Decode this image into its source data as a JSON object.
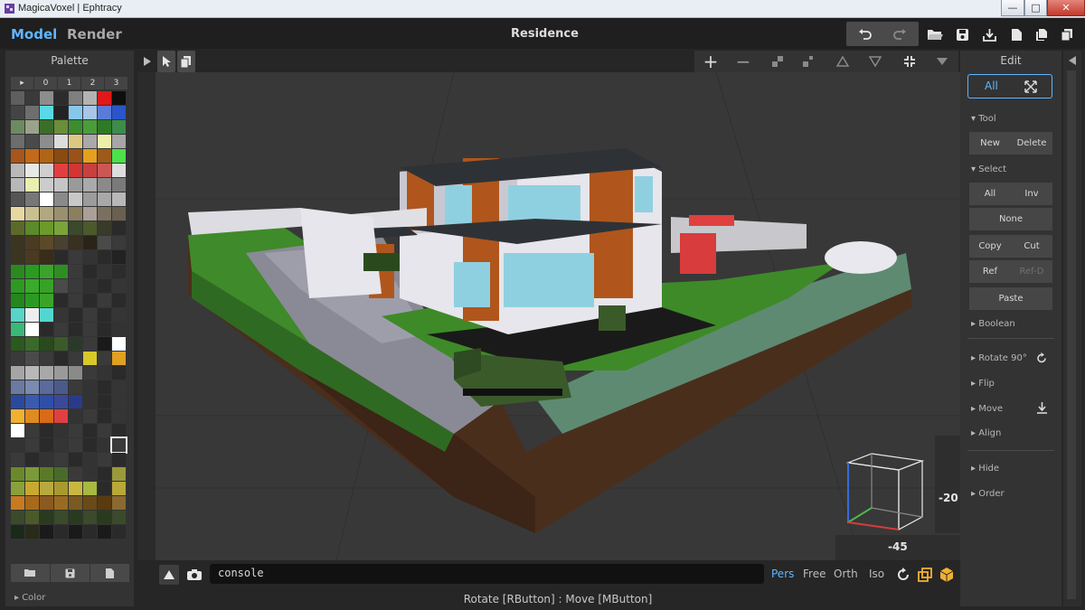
{
  "window": {
    "title": "MagicaVoxel | Ephtracy",
    "minimize_label": "—",
    "maximize_label": "□",
    "close_label": "✕"
  },
  "header": {
    "tabs": [
      {
        "label": "Model",
        "active": true
      },
      {
        "label": "Render",
        "active": false
      }
    ],
    "document_title": "Residence",
    "toolbar_icons": [
      "undo-icon",
      "redo-icon",
      "open-folder-icon",
      "save-icon",
      "export-icon",
      "new-file-icon",
      "copy-file-icon"
    ]
  },
  "palette": {
    "title": "Palette",
    "columns": [
      "▸",
      "0",
      "1",
      "2",
      "3"
    ],
    "section_label": "Color",
    "tools": [
      "open-folder-icon",
      "save-icon",
      "file-icon"
    ],
    "colors": [
      "#5f5f5f",
      "#3a3a3a",
      "#8d8d8d",
      "#2c2c2c",
      "#7f7f7f",
      "#b3b3b3",
      "#e01818",
      "#0e0e0e",
      "#444444",
      "#6e6e6e",
      "#5ad8e6",
      "#232323",
      "#86c8ec",
      "#a7c6e8",
      "#5a7cd8",
      "#2b55c9",
      "#6e8a61",
      "#9aa28a",
      "#3a6e2a",
      "#6a8e3a",
      "#3a8e2e",
      "#4a9e3a",
      "#2e7a26",
      "#3c8c4a",
      "#6d6d6d",
      "#4a4a4a",
      "#8d8d8d",
      "#dcdcdc",
      "#dcc883",
      "#a9a9a9",
      "#eeeeaa",
      "#a6a6a6",
      "#a8561a",
      "#c26a1a",
      "#b06418",
      "#8a4a10",
      "#9a5218",
      "#e6a020",
      "#9e5a1a",
      "#4ce04a",
      "#b9b9b9",
      "#e8e8e8",
      "#cfcfcf",
      "#e04040",
      "#d43434",
      "#c84040",
      "#cc5656",
      "#dddddd",
      "#b8b8b8",
      "#e8f0b0",
      "#cccccc",
      "#c5c5c5",
      "#9a9a9a",
      "#aaaaaa",
      "#8a8a8a",
      "#7a7a7a",
      "#555555",
      "#777777",
      "#ffffff",
      "#8a8a8a",
      "#c8c8c8",
      "#9c9c9c",
      "#a8a8a8",
      "#b8b8b8",
      "#e6d8a0",
      "#c8c090",
      "#b0a880",
      "#9a9070",
      "#8a8060",
      "#aaa098",
      "#7a7060",
      "#6a6050",
      "#5b6a2a",
      "#5a8a2a",
      "#6a9a2a",
      "#7aa43a",
      "#3a4a2a",
      "#4a5a2a",
      "#3a3a2a",
      "#2a2a2a",
      "#3b3520",
      "#4a3c22",
      "#5a4a2a",
      "#4a4030",
      "#3a3020",
      "#2a2418",
      "#4a4a4a",
      "#3a3a3a",
      "#3a3520",
      "#4a3a20",
      "#3a2c18",
      "#2a2a2a",
      "#3a3a3a",
      "#333333",
      "#2a2a2a",
      "#222222",
      "#2a8a1e",
      "#2a9a20",
      "#3aa42a",
      "#2e8e24",
      "#3a3a3a",
      "#2a2a2a",
      "#333333",
      "#2c2c2c",
      "#2e9a22",
      "#3aaa2a",
      "#36a226",
      "#4a4a4a",
      "#3a3a3a",
      "#303030",
      "#2a2a2a",
      "#353535",
      "#24861c",
      "#2c9a22",
      "#3aa42a",
      "#2a2a2a",
      "#3a3a3a",
      "#2a2a2a",
      "#3a3a3a",
      "#2a2a2a",
      "#58d4c8",
      "#eeeeee",
      "#54d6d0",
      "#353535",
      "#2a2a2a",
      "#3a3a3a",
      "#2a2a2a",
      "#353535",
      "#3ab878",
      "#ffffff",
      "#2a2a2a",
      "#3a3a3a",
      "#2a2a2a",
      "#3a3a3a",
      "#2a2a2a",
      "#333333",
      "#2a5a1e",
      "#3a6a2a",
      "#2a4a1e",
      "#3a5a2a",
      "#2a3a2a",
      "#3a3a3a",
      "#1a1a1a",
      "#ffffff",
      "#3a3a3a",
      "#4a4a4a",
      "#3a3a3a",
      "#2a2a2a",
      "#3a3a3a",
      "#d8c82a",
      "#3a3a3a",
      "#e0a020",
      "#a5a5a5",
      "#b8b8b8",
      "#a8a8a8",
      "#9a9a9a",
      "#8a8a8a",
      "#3a3a3a",
      "#333333",
      "#2a2a2a",
      "#6a7aa0",
      "#7a8ab0",
      "#5a6a9a",
      "#4a5a8a",
      "#3a3a3a",
      "#333333",
      "#2a2a2a",
      "#353535",
      "#2a4aa0",
      "#3a5ab0",
      "#2e4ea8",
      "#3a4a9a",
      "#2a3a8a",
      "#333333",
      "#2a2a2a",
      "#353535",
      "#f0b030",
      "#e08a20",
      "#d86a18",
      "#e04040",
      "#333333",
      "#3a3a3a",
      "#2a2a2a",
      "#353535",
      "#ffffff",
      "#3a3a3a",
      "#2a2a2a",
      "#333333",
      "#3a3a3a",
      "#2a2a2a",
      "#3a3a3a",
      "#2a2a2a",
      "#333333",
      "#3a3a3a",
      "#2a2a2a",
      "#353535",
      "#3a3a3a",
      "#2a2a2a",
      "#333333",
      "#3a3a3a",
      "#3a3a3a",
      "#2a2a2a",
      "#333333",
      "#3a3a3a",
      "#2a2a2a",
      "#333333",
      "#3a3a3a",
      "#2a2a2a",
      "#6a8a2a",
      "#7a9a3a",
      "#5a7a2a",
      "#4a6a2a",
      "#3a3a3a",
      "#333333",
      "#2a2a2a",
      "#9a9a3a",
      "#8aa03a",
      "#c8a830",
      "#b8a840",
      "#a89a30",
      "#c8b840",
      "#a8b840",
      "#2a2a2a",
      "#b8a838",
      "#c87a20",
      "#a86a18",
      "#8a5a20",
      "#9a6a20",
      "#7a5a20",
      "#6a4a18",
      "#5a3a10",
      "#8a6a30",
      "#3a4a2a",
      "#4a5a2a",
      "#2a3a1e",
      "#3a4a2a",
      "#2a3a1e",
      "#3a4a2a",
      "#2a3a1e",
      "#3a4a2a",
      "#1a2a1a",
      "#2a2a1a",
      "#1a1a1a",
      "#2a2a2a",
      "#1a1a1a",
      "#2a2a2a",
      "#1a1a1a",
      "#2a2a2a"
    ]
  },
  "viewport": {
    "console_text": "console",
    "projection_modes": [
      {
        "label": "Pers",
        "active": true
      },
      {
        "label": "Free",
        "active": false
      },
      {
        "label": "Orth",
        "active": false
      },
      {
        "label": "Iso",
        "active": false
      }
    ],
    "status_hint": "Rotate [RButton] : Move [MButton]",
    "camera_pitch": "-20",
    "camera_yaw": "-45"
  },
  "edit": {
    "title": "Edit",
    "scope_label": "All",
    "tool_section": "Tool",
    "tool_buttons": [
      "New",
      "Delete"
    ],
    "select_section": "Select",
    "select_buttons_row1": [
      "All",
      "Inv"
    ],
    "select_none": "None",
    "clip_buttons_row1": [
      "Copy",
      "Cut"
    ],
    "clip_buttons_row2": [
      "Ref",
      "Ref-D"
    ],
    "paste_label": "Paste",
    "sections": {
      "boolean": "Boolean",
      "rotate": "Rotate 90°",
      "flip": "Flip",
      "move": "Move",
      "align": "Align",
      "hide": "Hide",
      "order": "Order"
    }
  },
  "colors": {
    "accent": "#5fb6ff",
    "panel": "#333333",
    "background": "#262626",
    "viewport": "#383838"
  }
}
